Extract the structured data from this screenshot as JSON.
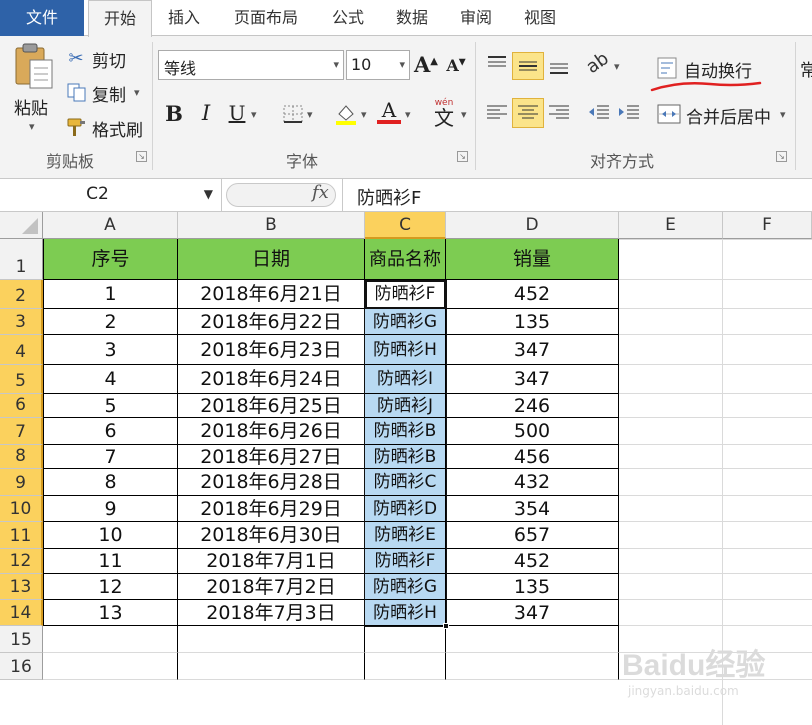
{
  "tabs": [
    {
      "label": "文件"
    },
    {
      "label": "开始"
    },
    {
      "label": "插入"
    },
    {
      "label": "页面布局"
    },
    {
      "label": "公式"
    },
    {
      "label": "数据"
    },
    {
      "label": "审阅"
    },
    {
      "label": "视图"
    }
  ],
  "clipboard": {
    "paste": "粘贴",
    "cut": "剪切",
    "copy": "复制",
    "format_painter": "格式刷",
    "group_label": "剪贴板"
  },
  "font": {
    "name": "等线",
    "size": "10",
    "grow": "A",
    "shrink": "A",
    "bold": "B",
    "italic": "I",
    "underline": "U",
    "color_letter": "A",
    "phonetic_top": "wén",
    "phonetic": "文",
    "group_label": "字体"
  },
  "alignment": {
    "wrap_text": "自动换行",
    "merge_center": "合并后居中",
    "group_label": "对齐方式",
    "next_group_partial": "常"
  },
  "accent_colors": {
    "file_tab": "#2e62a8",
    "header_fill": "#7dcc52",
    "selection_fill": "#b8d9f2",
    "selected_header": "#fbd15d",
    "annotation": "#e02020"
  },
  "formula_bar": {
    "name_box": "C2",
    "fx": "fx",
    "content": "防晒衫F"
  },
  "columns": [
    "A",
    "B",
    "C",
    "D",
    "E",
    "F"
  ],
  "row_numbers": [
    "1",
    "2",
    "3",
    "4",
    "5",
    "6",
    "7",
    "8",
    "9",
    "10",
    "11",
    "12",
    "13",
    "14",
    "15",
    "16"
  ],
  "table": {
    "headers": [
      "序号",
      "日期",
      "商品名称",
      "销量"
    ],
    "rows": [
      [
        "1",
        "2018年6月21日",
        "防晒衫F",
        "452"
      ],
      [
        "2",
        "2018年6月22日",
        "防晒衫G",
        "135"
      ],
      [
        "3",
        "2018年6月23日",
        "防晒衫H",
        "347"
      ],
      [
        "4",
        "2018年6月24日",
        "防晒衫I",
        "347"
      ],
      [
        "5",
        "2018年6月25日",
        "防晒衫J",
        "246"
      ],
      [
        "6",
        "2018年6月26日",
        "防晒衫B",
        "500"
      ],
      [
        "7",
        "2018年6月27日",
        "防晒衫B",
        "456"
      ],
      [
        "8",
        "2018年6月28日",
        "防晒衫C",
        "432"
      ],
      [
        "9",
        "2018年6月29日",
        "防晒衫D",
        "354"
      ],
      [
        "10",
        "2018年6月30日",
        "防晒衫E",
        "657"
      ],
      [
        "11",
        "2018年7月1日",
        "防晒衫F",
        "452"
      ],
      [
        "12",
        "2018年7月2日",
        "防晒衫G",
        "135"
      ],
      [
        "13",
        "2018年7月3日",
        "防晒衫H",
        "347"
      ]
    ]
  },
  "watermark": {
    "text": "Baidu经验",
    "sub": "jingyan.baidu.com"
  }
}
